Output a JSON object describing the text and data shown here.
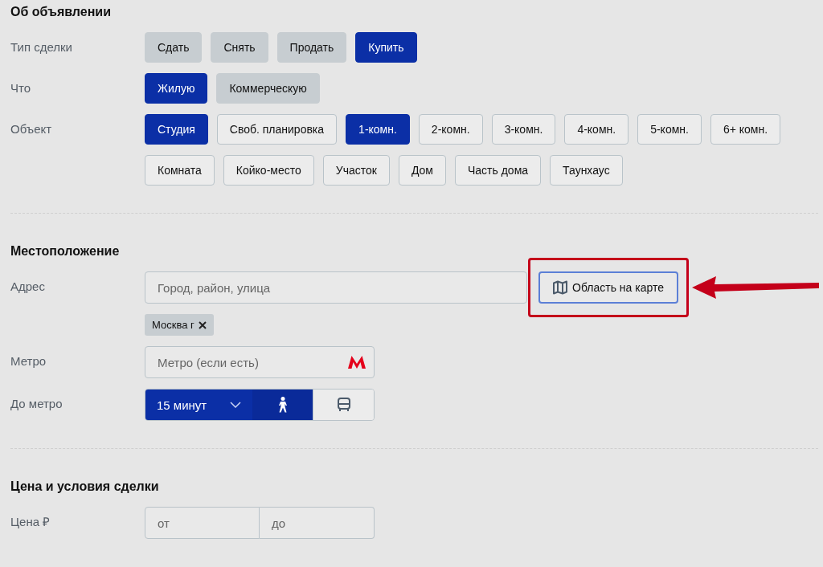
{
  "sections": [
    {
      "title": "Об объявлении",
      "fields": [
        {
          "kind": "toggle",
          "label": "Тип сделки",
          "rows": [
            [
              {
                "label": "Сдать",
                "selected": false
              },
              {
                "label": "Снять",
                "selected": false
              },
              {
                "label": "Продать",
                "selected": false
              },
              {
                "label": "Купить",
                "selected": true
              }
            ]
          ]
        },
        {
          "kind": "toggle",
          "label": "Что",
          "rows": [
            [
              {
                "label": "Жилую",
                "selected": true
              },
              {
                "label": "Коммерческую",
                "selected": false
              }
            ]
          ]
        },
        {
          "kind": "chips",
          "label": "Объект",
          "rows": [
            [
              {
                "label": "Студия",
                "selected": true
              },
              {
                "label": "Своб. планировка",
                "selected": false
              },
              {
                "label": "1-комн.",
                "selected": true
              },
              {
                "label": "2-комн.",
                "selected": false
              },
              {
                "label": "3-комн.",
                "selected": false
              },
              {
                "label": "4-комн.",
                "selected": false
              },
              {
                "label": "5-комн.",
                "selected": false
              },
              {
                "label": "6+ комн.",
                "selected": false
              }
            ],
            [
              {
                "label": "Комната",
                "selected": false
              },
              {
                "label": "Койко-место",
                "selected": false
              },
              {
                "label": "Участок",
                "selected": false
              },
              {
                "label": "Дом",
                "selected": false
              },
              {
                "label": "Часть дома",
                "selected": false
              },
              {
                "label": "Таунхаус",
                "selected": false
              }
            ]
          ]
        }
      ]
    },
    {
      "title": "Местоположение",
      "fields": [
        {
          "kind": "address",
          "label": "Адрес",
          "placeholder": "Город, район, улица",
          "map_button": {
            "label": "Область на карте",
            "highlighted": true
          },
          "tags": [
            {
              "label": "Москва г"
            }
          ]
        },
        {
          "kind": "metro",
          "label": "Метро",
          "placeholder": "Метро (если есть)"
        },
        {
          "kind": "distance",
          "label": "До метро",
          "value": "15 минут",
          "modes": [
            {
              "kind": "walk",
              "selected": true
            },
            {
              "kind": "transport",
              "selected": false
            }
          ]
        }
      ]
    },
    {
      "title": "Цена и условия сделки",
      "fields": [
        {
          "kind": "range",
          "label": "Цена ₽",
          "from_placeholder": "от",
          "to_placeholder": "до"
        }
      ]
    }
  ]
}
